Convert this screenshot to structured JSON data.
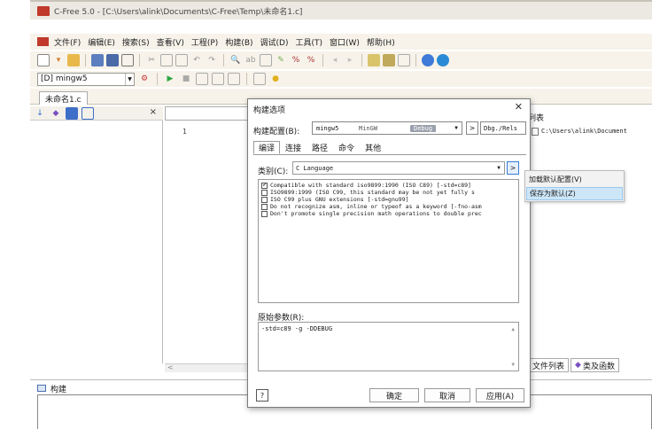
{
  "window": {
    "title": "C-Free 5.0 - [C:\\Users\\alink\\Documents\\C-Free\\Temp\\未命名1.c]"
  },
  "menu": [
    "文件(F)",
    "编辑(E)",
    "搜索(S)",
    "查看(V)",
    "工程(P)",
    "构建(B)",
    "调试(D)",
    "工具(T)",
    "窗口(W)",
    "帮助(H)"
  ],
  "toolbar": {
    "compiler": "[D] mingw5"
  },
  "document_tab": "未命名1.c",
  "editor": {
    "line_number": "1"
  },
  "file_list": {
    "title": "列表",
    "entry": "C:\\Users\\alink\\Document",
    "tabs": [
      "文件列表",
      "类及函数"
    ]
  },
  "build_panel": {
    "tab": "构建"
  },
  "dialog": {
    "title": "构建选项",
    "config_label": "构建配置(B):",
    "config": {
      "compiler": "mingw5",
      "type": "MinGW",
      "badge": "Debug",
      "output": "Dbg./Rels"
    },
    "tabs": [
      "编译",
      "连接",
      "路径",
      "命令",
      "其他"
    ],
    "active_tab": 0,
    "category_label": "类别(C):",
    "category_value": "C Language",
    "options": [
      {
        "checked": true,
        "text": "Compatible with standard iso9899:1990 (ISO C89) [-std=c89]"
      },
      {
        "checked": false,
        "text": "ISO9899:1999 (ISO C99, this standard may be not yet fully s"
      },
      {
        "checked": false,
        "text": "ISO C99 plus GNU extensions [-std=gnu99]"
      },
      {
        "checked": false,
        "text": "Do not recognize asm, inline or typeof as a keyword [-fno-asm"
      },
      {
        "checked": false,
        "text": "Don't promote single precision math operations to double prec"
      }
    ],
    "raw_label": "原始参数(R):",
    "raw_value": "-std=c89 -g -DDEBUG",
    "buttons": {
      "help": "?",
      "ok": "确定",
      "cancel": "取消",
      "apply": "应用(A)"
    }
  },
  "context_menu": {
    "items": [
      "加载默认配置(V)",
      "保存为默认(Z)"
    ],
    "highlighted": 1
  },
  "colors": {
    "highlight": "#cde6f7",
    "debug_badge": "#9aa1ad",
    "app_icon": "#c0392b"
  }
}
